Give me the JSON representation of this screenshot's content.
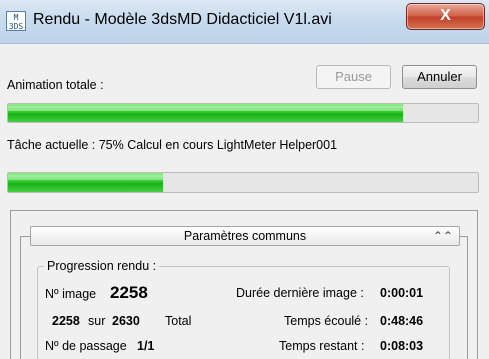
{
  "window": {
    "icon_text": "M\n3DS",
    "title": "Rendu - Modèle 3dsMD Didacticiel V1l.avi",
    "close_glyph": "X"
  },
  "animation": {
    "label": "Animation totale :",
    "progress": 0.84
  },
  "buttons": {
    "pause": "Pause",
    "cancel": "Annuler"
  },
  "task": {
    "label": "Tâche actuelle : 75% Calcul en cours LightMeter Helper001",
    "progress": 0.33
  },
  "rollout": {
    "title": "Paramètres communs",
    "collapse_glyph": "⌃"
  },
  "progress_group": {
    "title": "Progression rendu :",
    "image_label": "Nº image",
    "image_value": "2258",
    "count_current": "2258",
    "count_sep": "sur",
    "count_total": "2630",
    "total_label": "Total",
    "pass_label": "Nº de passage",
    "pass_value": "1/1",
    "last_frame_label": "Durée dernière image :",
    "last_frame_value": "0:00:01",
    "elapsed_label": "Temps écoulé :",
    "elapsed_value": "0:48:46",
    "remaining_label": "Temps restant :",
    "remaining_value": "0:08:03"
  },
  "colors": {
    "progress_green": "#22c020",
    "close_red": "#c7442c"
  }
}
